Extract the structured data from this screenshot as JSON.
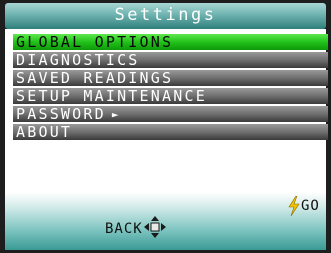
{
  "title": "Settings",
  "menu": {
    "items": [
      {
        "label": "GLOBAL OPTIONS",
        "selected": true
      },
      {
        "label": "DIAGNOSTICS",
        "selected": false
      },
      {
        "label": "SAVED READINGS",
        "selected": false
      },
      {
        "label": "SETUP MAINTENANCE",
        "selected": false
      },
      {
        "label": "PASSWORD",
        "selected": false,
        "has_submenu": true,
        "arrow": "►"
      },
      {
        "label": "ABOUT",
        "selected": false
      }
    ]
  },
  "softkeys": {
    "back_label": "BACK",
    "go_label": "GO",
    "back_icon": "dpad-icon",
    "go_icon": "lightning-bolt-icon"
  },
  "colors": {
    "selected_row": "#22c21a",
    "row": "#6f6f6f",
    "title_bar": "#6fb3b0",
    "footer": "#7fc5c1",
    "bolt": "#f2c200"
  }
}
